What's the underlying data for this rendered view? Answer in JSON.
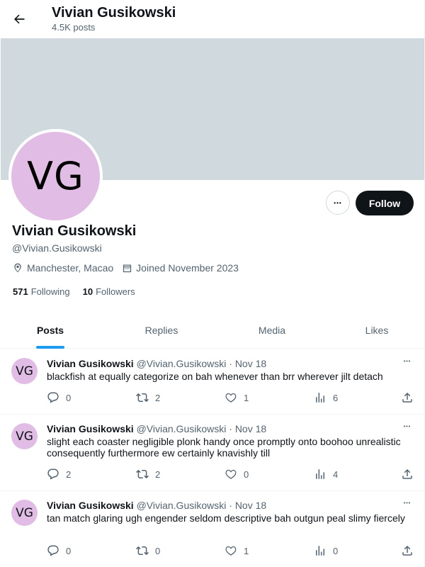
{
  "header": {
    "name": "Vivian Gusikowski",
    "post_count": "4.5K posts"
  },
  "profile": {
    "avatar_initials": "VG",
    "name": "Vivian Gusikowski",
    "handle": "@Vivian.Gusikowski",
    "location": "Manchester, Macao",
    "joined": "Joined November 2023",
    "following_count": "571",
    "following_label": "Following",
    "followers_count": "10",
    "followers_label": "Followers",
    "more_label": "•••",
    "follow_label": "Follow"
  },
  "tabs": [
    {
      "label": "Posts",
      "active": true
    },
    {
      "label": "Replies",
      "active": false
    },
    {
      "label": "Media",
      "active": false
    },
    {
      "label": "Likes",
      "active": false
    }
  ],
  "posts": [
    {
      "avatar": "VG",
      "name": "Vivian Gusikowski",
      "handle": "@Vivian.Gusikowski",
      "dot": "·",
      "date": "Nov 18",
      "more": "•••",
      "text": "blackfish at equally categorize on bah whenever than brr wherever jilt detach",
      "replies": "0",
      "reposts": "2",
      "likes": "1",
      "views": "6"
    },
    {
      "avatar": "VG",
      "name": "Vivian Gusikowski",
      "handle": "@Vivian.Gusikowski",
      "dot": "·",
      "date": "Nov 18",
      "more": "•••",
      "text": "slight each coaster negligible plonk handy once promptly onto boohoo unrealistic consequently furthermore ew certainly knavishly till",
      "replies": "2",
      "reposts": "2",
      "likes": "0",
      "views": "4"
    },
    {
      "avatar": "VG",
      "name": "Vivian Gusikowski",
      "handle": "@Vivian.Gusikowski",
      "dot": "·",
      "date": "Nov 18",
      "more": "•••",
      "text": "tan match glaring ugh engender seldom descriptive bah outgun peal slimy fiercely",
      "replies": "0",
      "reposts": "0",
      "likes": "1",
      "views": "0"
    }
  ],
  "colors": {
    "banner": "#cfd9de",
    "avatar": "#e1bde6",
    "accent": "#1d9bf0",
    "text": "#0f1419",
    "muted": "#536471"
  }
}
